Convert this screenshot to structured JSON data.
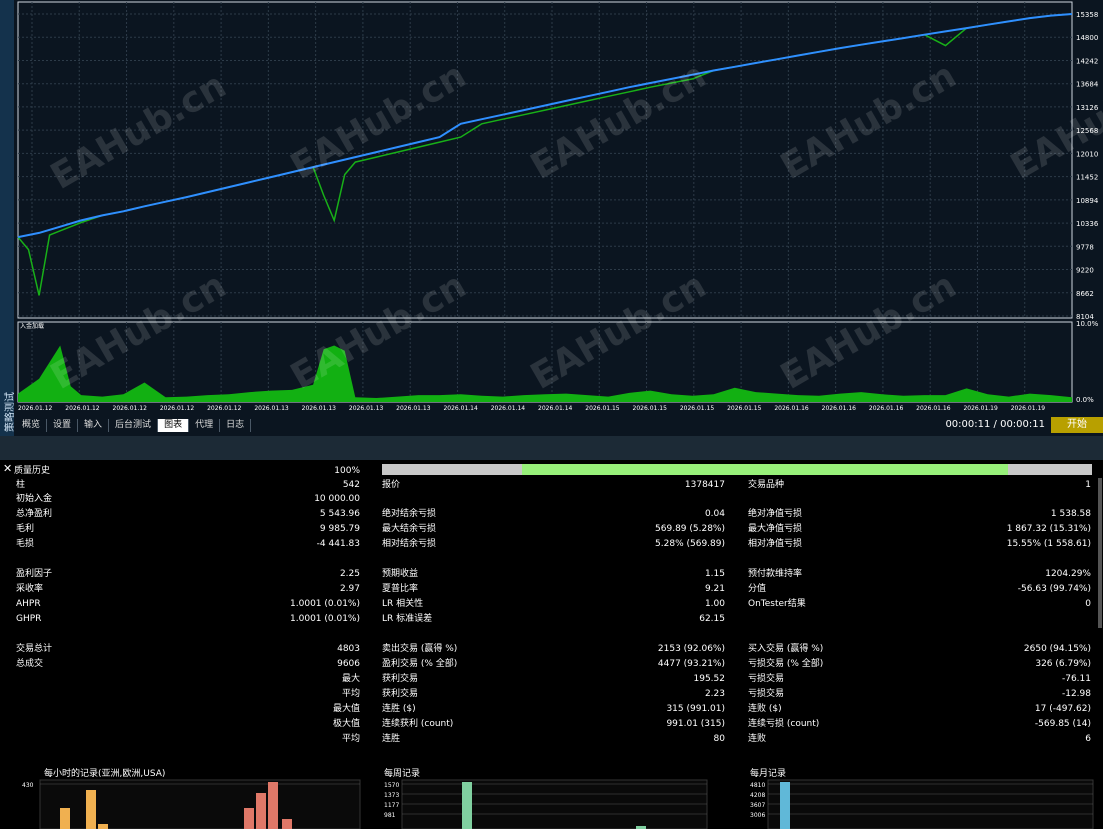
{
  "sidebar_label": "策略测试",
  "tabs": [
    {
      "label": "概览",
      "active": false
    },
    {
      "label": "设置",
      "active": false
    },
    {
      "label": "输入",
      "active": false
    },
    {
      "label": "后台测试",
      "active": false
    },
    {
      "label": "图表",
      "active": true
    },
    {
      "label": "代理",
      "active": false
    },
    {
      "label": "日志",
      "active": false
    }
  ],
  "timer": "00:00:11 / 00:00:11",
  "start_button": "开始",
  "watermark": "EAHub.cn",
  "deposit_label": "入金加载",
  "colors": {
    "balance": "#2f8fff",
    "equity": "#18b018",
    "deposit": "#12b012",
    "grid": "#2d3b48",
    "bg": "#0b1520"
  },
  "chart_data": [
    {
      "type": "line",
      "y_ticks": [
        "15358",
        "14800",
        "14242",
        "13684",
        "13126",
        "12568",
        "12010",
        "11452",
        "10894",
        "10336",
        "9778",
        "9220",
        "8662",
        "8104"
      ],
      "ylim": [
        8104,
        15358
      ],
      "x_ticks": [
        "2026.01.12",
        "2026.01.12",
        "2026.01.12",
        "2026.01.12",
        "2026.01.12",
        "2026.01.13",
        "2026.01.13",
        "2026.01.13",
        "2026.01.13",
        "2026.01.14",
        "2026.01.14",
        "2026.01.14",
        "2026.01.15",
        "2026.01.15",
        "2026.01.15",
        "2026.01.15",
        "2026.01.16",
        "2026.01.16",
        "2026.01.16",
        "2026.01.16",
        "2026.01.19",
        "2026.01.19"
      ],
      "series": [
        {
          "x": [
            0,
            2,
            4,
            6,
            8,
            10,
            12,
            14,
            16,
            18,
            20,
            22,
            24,
            26,
            28,
            30,
            32,
            34,
            36,
            38,
            40,
            42,
            44,
            46,
            48,
            50,
            52,
            54,
            56,
            58,
            60,
            62,
            64,
            66,
            68,
            70,
            72,
            74,
            76,
            78,
            80,
            82,
            84,
            86,
            88,
            90,
            92,
            94,
            96,
            98,
            100
          ],
          "values": [
            10000,
            10100,
            10250,
            10400,
            10520,
            10620,
            10740,
            10850,
            10960,
            11080,
            11200,
            11320,
            11440,
            11560,
            11680,
            11800,
            11920,
            12040,
            12160,
            12280,
            12400,
            12720,
            12830,
            12940,
            13050,
            13160,
            13270,
            13380,
            13490,
            13600,
            13700,
            13800,
            13900,
            14000,
            14090,
            14180,
            14270,
            14360,
            14450,
            14540,
            14620,
            14700,
            14780,
            14860,
            14940,
            15020,
            15100,
            15180,
            15260,
            15320,
            15358
          ]
        },
        {
          "x": [
            0,
            1,
            2,
            3,
            4,
            5,
            6,
            8,
            10,
            12,
            14,
            16,
            18,
            20,
            22,
            24,
            26,
            28,
            29,
            30,
            31,
            32,
            34,
            36,
            38,
            40,
            42,
            44,
            46,
            48,
            50,
            52,
            54,
            56,
            58,
            60,
            62,
            64,
            66,
            68,
            70,
            72,
            74,
            76,
            78,
            80,
            82,
            84,
            86,
            88,
            90,
            92,
            94,
            96,
            98,
            100
          ],
          "values": [
            10000,
            9700,
            8600,
            10050,
            10150,
            10250,
            10350,
            10520,
            10620,
            10740,
            10850,
            10960,
            11080,
            11200,
            11320,
            11440,
            11560,
            11680,
            11000,
            10400,
            11500,
            11800,
            11920,
            12040,
            12160,
            12280,
            12400,
            12720,
            12830,
            12940,
            13050,
            13160,
            13270,
            13380,
            13490,
            13600,
            13700,
            13800,
            14000,
            14090,
            14180,
            14270,
            14360,
            14450,
            14540,
            14620,
            14700,
            14780,
            14860,
            14600,
            15020,
            15100,
            15180,
            15260,
            15320,
            15358
          ]
        }
      ]
    },
    {
      "type": "area",
      "y_ticks": [
        "10.0%",
        "0.0%"
      ],
      "ylim": [
        0,
        10
      ],
      "x": [
        0,
        2,
        4,
        5,
        6,
        8,
        10,
        12,
        14,
        16,
        18,
        20,
        22,
        24,
        26,
        28,
        29,
        30,
        31,
        32,
        34,
        36,
        38,
        40,
        42,
        44,
        46,
        48,
        50,
        52,
        54,
        56,
        58,
        60,
        62,
        64,
        66,
        68,
        70,
        72,
        74,
        76,
        78,
        80,
        82,
        84,
        86,
        88,
        90,
        92,
        94,
        96,
        98,
        100
      ],
      "values": [
        1,
        3,
        7.5,
        2,
        0.8,
        0.6,
        0.9,
        2.5,
        0.5,
        0.6,
        0.8,
        0.9,
        1.2,
        1.4,
        1.5,
        2.2,
        7.0,
        7.5,
        6.8,
        0.5,
        0.4,
        0.6,
        0.8,
        0.8,
        0.9,
        0.7,
        0.6,
        0.8,
        0.9,
        1.0,
        0.8,
        0.6,
        1.1,
        1.4,
        0.9,
        0.7,
        0.9,
        1.8,
        1.2,
        1.0,
        0.8,
        0.7,
        1.0,
        1.2,
        0.9,
        0.7,
        0.8,
        0.8,
        1.7,
        0.9,
        0.6,
        1.0,
        0.8,
        0.5
      ]
    },
    {
      "type": "bar",
      "title": "每小时的记录(亚洲,欧洲,USA)",
      "y_ticks": [
        "430"
      ],
      "ylim": [
        0,
        430
      ]
    },
    {
      "type": "bar",
      "title": "每周记录",
      "y_ticks": [
        "1570",
        "1373",
        "1177",
        "981"
      ],
      "ylim": [
        0,
        1570
      ]
    },
    {
      "type": "bar",
      "title": "每月记录",
      "y_ticks": [
        "4810",
        "4208",
        "3607",
        "3006"
      ],
      "ylim": [
        0,
        4810
      ]
    }
  ],
  "quality": {
    "label": "质量历史",
    "value": "100%"
  },
  "rows": [
    {
      "top": 6,
      "c1": "柱",
      "v1": "542",
      "c2": "报价",
      "v2": "1378417",
      "c3": "交易品种",
      "v3": "1"
    },
    {
      "top": 20,
      "c1": "初始入金",
      "v1": "10 000.00"
    },
    {
      "top": 35,
      "c1": "总净盈利",
      "v1": "5 543.96",
      "c2": "绝对结余亏损",
      "v2": "0.04",
      "c3": "绝对净值亏损",
      "v3": "1 538.58"
    },
    {
      "top": 50,
      "c1": "毛利",
      "v1": "9 985.79",
      "c2": "最大结余亏损",
      "v2": "569.89 (5.28%)",
      "c3": "最大净值亏损",
      "v3": "1 867.32 (15.31%)"
    },
    {
      "top": 65,
      "c1": "毛损",
      "v1": "-4 441.83",
      "c2": "相对结余亏损",
      "v2": "5.28% (569.89)",
      "c3": "相对净值亏损",
      "v3": "15.55% (1 558.61)"
    },
    {
      "top": 95,
      "c1": "盈利因子",
      "v1": "2.25",
      "c2": "预期收益",
      "v2": "1.15",
      "c3": "预付款维持率",
      "v3": "1204.29%"
    },
    {
      "top": 110,
      "c1": "采收率",
      "v1": "2.97",
      "c2": "夏普比率",
      "v2": "9.21",
      "c3": "分值",
      "v3": "-56.63 (99.74%)"
    },
    {
      "top": 125,
      "c1": "AHPR",
      "v1": "1.0001 (0.01%)",
      "c2": "LR 相关性",
      "v2": "1.00",
      "c3": "OnTester结果",
      "v3": "0"
    },
    {
      "top": 140,
      "c1": "GHPR",
      "v1": "1.0001 (0.01%)",
      "c2": "LR 标准误差",
      "v2": "62.15"
    },
    {
      "top": 170,
      "c1": "交易总计",
      "v1": "4803",
      "c2": "卖出交易 (赢得 %)",
      "v2": "2153 (92.06%)",
      "c3": "买入交易 (赢得 %)",
      "v3": "2650 (94.15%)"
    },
    {
      "top": 185,
      "c1": "总成交",
      "v1": "9606",
      "c2": "盈利交易 (% 全部)",
      "v2": "4477 (93.21%)",
      "c3": "亏损交易 (% 全部)",
      "v3": "326 (6.79%)"
    },
    {
      "top": 200,
      "v1": "最大",
      "c2": "获利交易",
      "v2": "195.52",
      "c3": "亏损交易",
      "v3": "-76.11"
    },
    {
      "top": 215,
      "v1": "平均",
      "c2": "获利交易",
      "v2": "2.23",
      "c3": "亏损交易",
      "v3": "-12.98"
    },
    {
      "top": 230,
      "v1": "最大值",
      "c2": "连胜 ($)",
      "v2": "315 (991.01)",
      "c3": "连败 ($)",
      "v3": "17 (-497.62)"
    },
    {
      "top": 245,
      "v1": "极大值",
      "c2": "连续获利 (count)",
      "v2": "991.01 (315)",
      "c3": "连续亏损 (count)",
      "v3": "-569.85 (14)"
    },
    {
      "top": 260,
      "v1": "平均",
      "c2": "连胜",
      "v2": "80",
      "c3": "连败",
      "v3": "6"
    }
  ]
}
